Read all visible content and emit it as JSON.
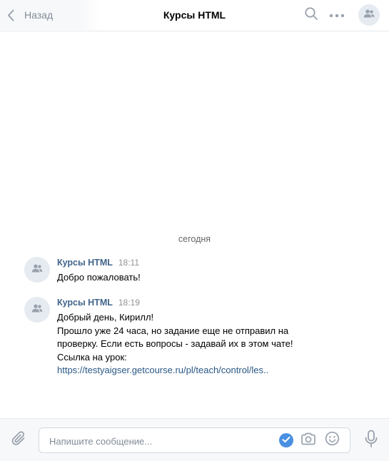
{
  "header": {
    "back_label": "Назад",
    "title": "Курсы HTML"
  },
  "messages": {
    "date_separator": "сегодня",
    "items": [
      {
        "author": "Курсы HTML",
        "time": "18:11",
        "lines": [
          "Добро пожаловать!"
        ]
      },
      {
        "author": "Курсы HTML",
        "time": "18:19",
        "lines": [
          "Добрый день, Кирилл!",
          "Прошло уже 24 часа, но задание еще не отправил на",
          "проверку. Если есть вопросы - задавай их в этом чате!",
          "Ссылка на урок:"
        ],
        "link": "https://testyaigser.getcourse.ru/pl/teach/control/les.."
      }
    ]
  },
  "composer": {
    "placeholder": "Напишите сообщение...",
    "value": ""
  },
  "colors": {
    "accent": "#4a90e2",
    "author": "#42648b",
    "link": "#2a5885",
    "icon": "#99a2ad"
  },
  "icons": {
    "back": "chevron-left-icon",
    "search": "search-icon",
    "more": "more-dots-icon",
    "header_avatar": "group-avatar-icon",
    "attach": "paperclip-icon",
    "check": "checkmark-icon",
    "camera": "camera-icon",
    "smile": "smile-icon",
    "mic": "microphone-icon"
  }
}
